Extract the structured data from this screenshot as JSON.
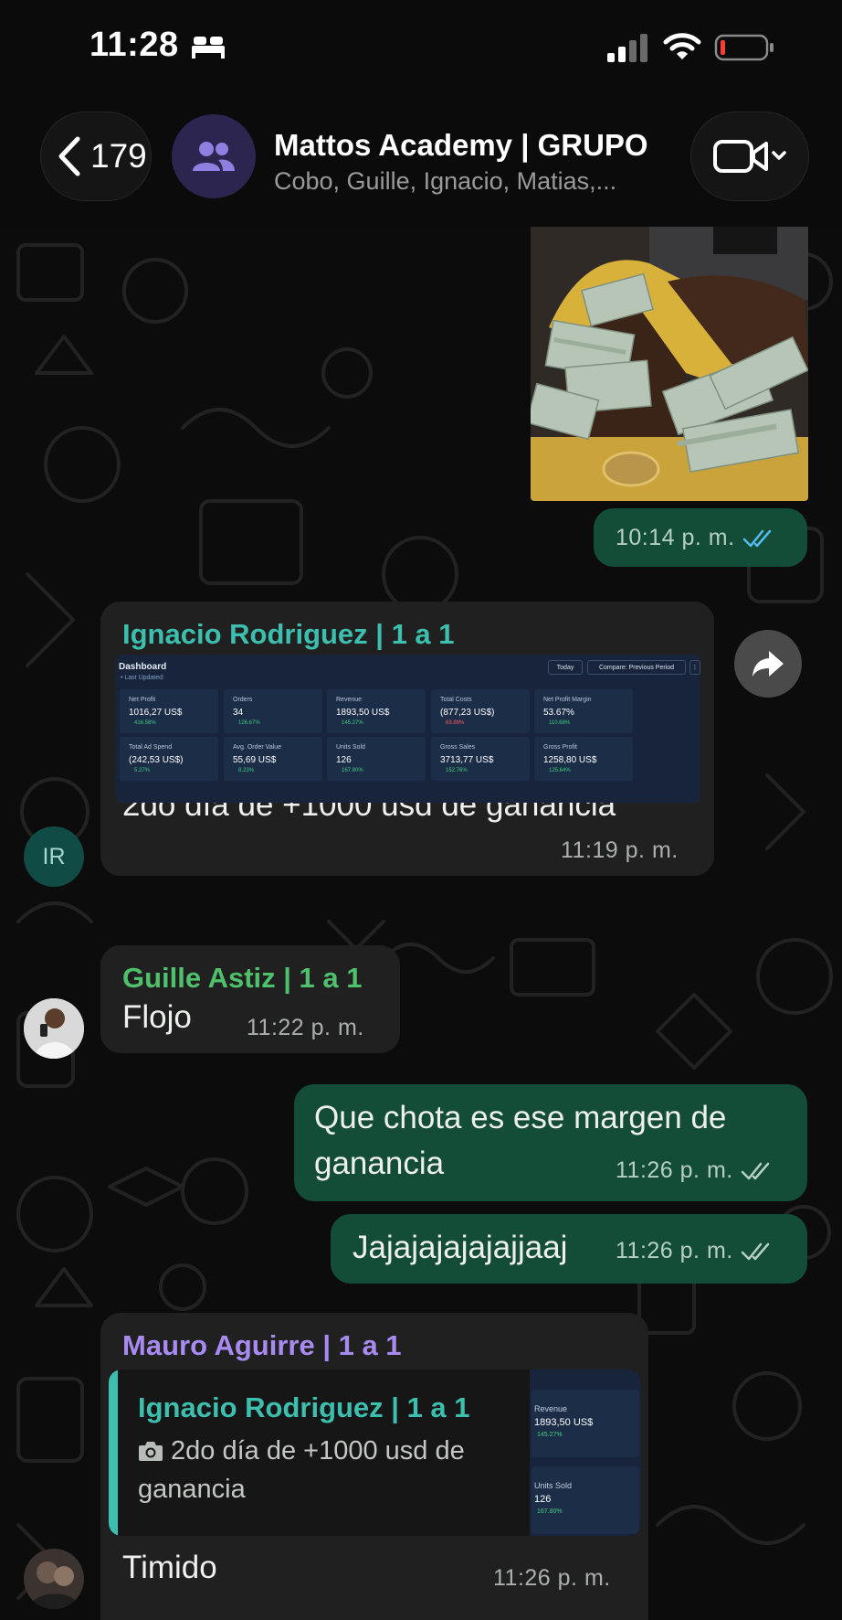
{
  "status_bar": {
    "time": "11:28",
    "icons": [
      "sleep-bed-icon",
      "cellular-signal-icon",
      "wifi-icon",
      "battery-low-icon"
    ],
    "battery_color": "#ff3b30"
  },
  "header": {
    "back_count": "179",
    "title": "Mattos Academy | GRUPO",
    "subtitle": "Cobo, Guille, Ignacio, Matias,...",
    "avatar_icon": "group-icon",
    "call_icon": "video-call-icon"
  },
  "colors": {
    "outgoing_bubble": "#134d37",
    "incoming_bubble": "#202020",
    "ticks": "#53bdeb"
  },
  "messages": [
    {
      "direction": "out",
      "type": "image",
      "image": "money-photo",
      "time": "10:14 p. m.",
      "status": "read"
    },
    {
      "direction": "in",
      "sender": "Ignacio Rodriguez | 1 a 1",
      "sender_color": "#3cbfae",
      "avatar": "IR",
      "text": "2do día de +1000 usd de ganancia",
      "time": "11:19 p. m.",
      "dashboard": {
        "title": "Dashboard",
        "subtitle": "• Last Updated:",
        "today_button": "Today",
        "compare_button": "Compare: Previous Period",
        "kpis": [
          {
            "label": "Net Profit",
            "value": "1016,27 US$",
            "delta": "416.58%",
            "trend": "up"
          },
          {
            "label": "Orders",
            "value": "34",
            "delta": "126.67%",
            "trend": "up"
          },
          {
            "label": "Revenue",
            "value": "1893,50 US$",
            "delta": "145.27%",
            "trend": "up"
          },
          {
            "label": "Total Costs",
            "value": "(877,23 US$)",
            "delta": "63.89%",
            "trend": "down"
          },
          {
            "label": "Net Profit Margin",
            "value": "53.67%",
            "delta": "110.68%",
            "trend": "up"
          },
          {
            "label": "Total Ad Spend",
            "value": "(242,53 US$)",
            "delta": "5.27%",
            "trend": "up"
          },
          {
            "label": "Avg. Order Value",
            "value": "55,69 US$",
            "delta": "8.23%",
            "trend": "up"
          },
          {
            "label": "Units Sold",
            "value": "126",
            "delta": "167.80%",
            "trend": "up"
          },
          {
            "label": "Gross Sales",
            "value": "3713,77 US$",
            "delta": "152.76%",
            "trend": "up"
          },
          {
            "label": "Gross Profit",
            "value": "1258,80 US$",
            "delta": "125.64%",
            "trend": "up"
          }
        ]
      }
    },
    {
      "direction": "in",
      "sender": "Guille Astiz | 1 a 1",
      "sender_color": "#4fc06b",
      "text": "Flojo",
      "time": "11:22 p. m."
    },
    {
      "direction": "out",
      "text_line1": "Que chota es ese margen de",
      "text_line2": "ganancia",
      "time": "11:26 p. m.",
      "status": "delivered"
    },
    {
      "direction": "out",
      "text": "Jajajajajajajjaaj",
      "time": "11:26 p. m.",
      "status": "delivered"
    },
    {
      "direction": "in",
      "sender": "Mauro Aguirre | 1 a 1",
      "sender_color": "#a78bf0",
      "text": "Timido",
      "time": "11:26 p. m.",
      "quote": {
        "sender": "Ignacio Rodriguez | 1 a 1",
        "text": "2do día de +1000 usd de ganancia",
        "icon": "camera-icon",
        "thumb": [
          {
            "label": "Revenue",
            "value": "1893,50 US$",
            "delta": "145.27%"
          },
          {
            "label": "Units Sold",
            "value": "126",
            "delta": "167.80%"
          }
        ]
      }
    }
  ]
}
